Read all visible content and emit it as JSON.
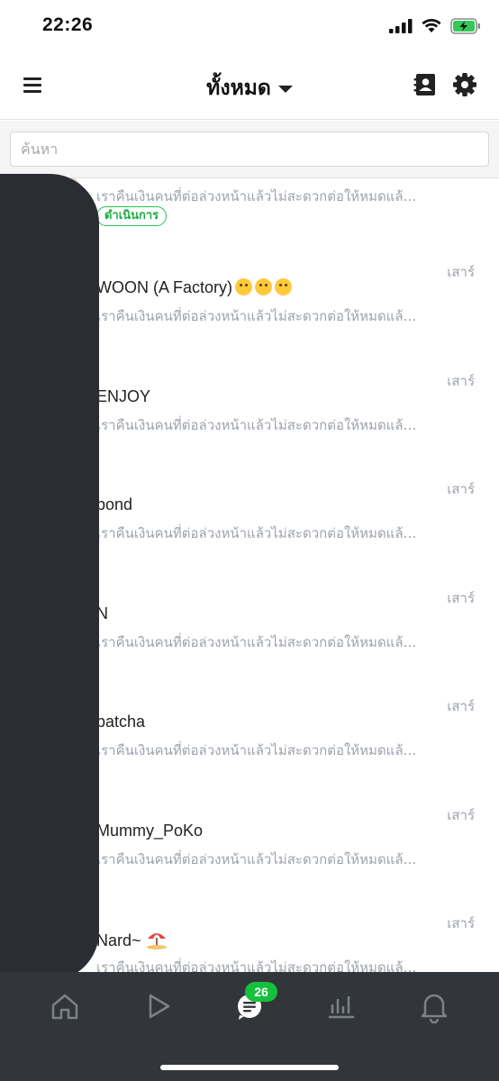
{
  "status_bar": {
    "time": "22:26"
  },
  "header": {
    "title": "ทั้งหมด"
  },
  "search": {
    "placeholder": "ค้นหา",
    "value": ""
  },
  "chats": [
    {
      "name": "",
      "preview": "เราคืนเงินคนที่ต่อล่วงหน้าแล้วไม่สะดวกต่อให้หมดแล้ว...",
      "time": "",
      "status": "ดำเนินการ",
      "emojis": []
    },
    {
      "name": "WOON (A Factory)",
      "preview": "เราคืนเงินคนที่ต่อล่วงหน้าแล้วไม่สะดวกต่อให้หมดแล้ว...",
      "time": "เสาร์",
      "emojis": [
        "yum-face-icon",
        "smiling-face-icon",
        "zany-face-icon"
      ]
    },
    {
      "name": "ENJOY",
      "preview": "เราคืนเงินคนที่ต่อล่วงหน้าแล้วไม่สะดวกต่อให้หมดแล้ว...",
      "time": "เสาร์"
    },
    {
      "name": "pond",
      "preview": "เราคืนเงินคนที่ต่อล่วงหน้าแล้วไม่สะดวกต่อให้หมดแล้ว...",
      "time": "เสาร์"
    },
    {
      "name": "N",
      "preview": "เราคืนเงินคนที่ต่อล่วงหน้าแล้วไม่สะดวกต่อให้หมดแล้ว...",
      "time": "เสาร์"
    },
    {
      "name": "patcha",
      "preview": "เราคืนเงินคนที่ต่อล่วงหน้าแล้วไม่สะดวกต่อให้หมดแล้ว...",
      "time": "เสาร์"
    },
    {
      "name": "Mummy_PoKo",
      "preview": "เราคืนเงินคนที่ต่อล่วงหน้าแล้วไม่สะดวกต่อให้หมดแล้ว...",
      "time": "เสาร์"
    },
    {
      "name": "Nard~",
      "preview": "เราคืนเงินคนที่ต่อล่วงหน้าแล้วไม่สะดวกต่อให้หมดแล้ว...",
      "time": "เสาร์",
      "emojis": [
        "beach-umbrella-icon"
      ]
    }
  ],
  "tabbar": {
    "tabs": [
      "home-icon",
      "play-icon",
      "chat-icon",
      "analytics-icon",
      "bell-icon"
    ],
    "chat_badge": "26"
  },
  "colors": {
    "accent_green": "#16c03c",
    "tabbar_bg": "#32363b",
    "preview_gray": "#9da3ab"
  }
}
